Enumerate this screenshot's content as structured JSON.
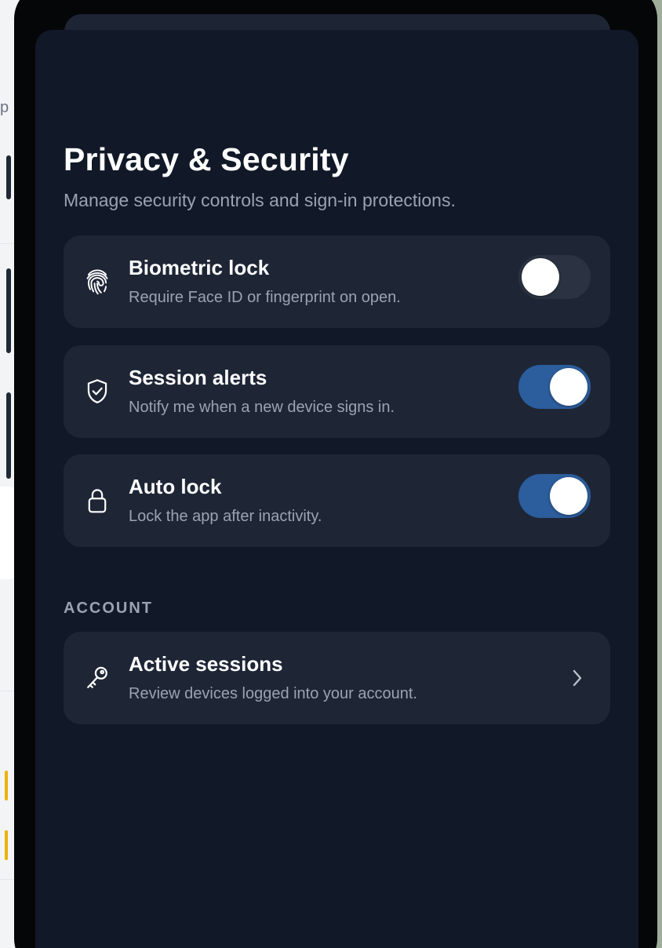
{
  "page": {
    "title": "Privacy & Security",
    "subtitle": "Manage security controls and sign-in protections."
  },
  "settings": [
    {
      "icon": "fingerprint-icon",
      "label": "Biometric lock",
      "description": "Require Face ID or fingerprint on open.",
      "enabled": false
    },
    {
      "icon": "shield-check-icon",
      "label": "Session alerts",
      "description": "Notify me when a new device signs in.",
      "enabled": true
    },
    {
      "icon": "lock-icon",
      "label": "Auto lock",
      "description": "Lock the app after inactivity.",
      "enabled": true
    }
  ],
  "account": {
    "section_label": "ACCOUNT",
    "items": [
      {
        "icon": "key-icon",
        "label": "Active sessions",
        "description": "Review devices logged into your account."
      }
    ]
  },
  "colors": {
    "sheet_background": "#111827",
    "card_background": "#1e2636",
    "toggle_on": "#2c5d9c",
    "toggle_off": "#2b3342",
    "secondary_text": "#9aa3b2"
  }
}
